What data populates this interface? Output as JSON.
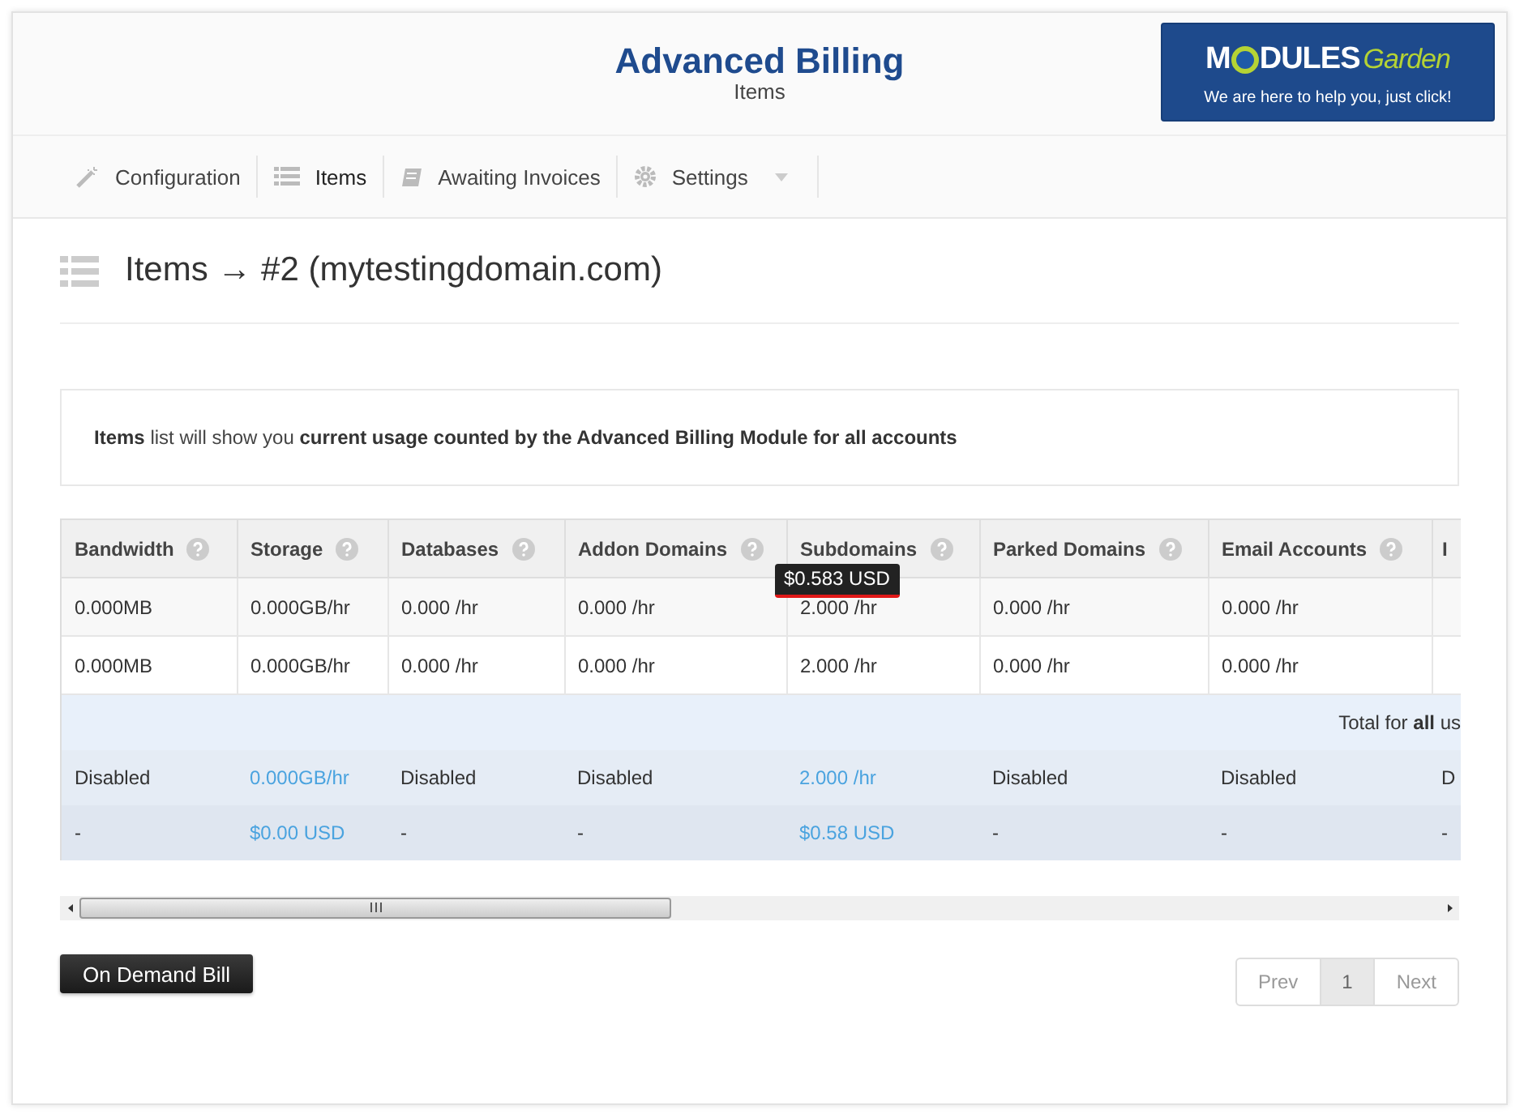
{
  "header": {
    "title": "Advanced Billing",
    "subtitle": "Items",
    "logo": {
      "brand_left": "M",
      "brand_mid": "DULES",
      "brand_right": "Garden",
      "tagline": "We are here to help you, just click!"
    }
  },
  "nav": [
    {
      "label": "Configuration",
      "selected": false,
      "dropdown": false
    },
    {
      "label": "Items",
      "selected": true,
      "dropdown": false
    },
    {
      "label": "Awaiting Invoices",
      "selected": false,
      "dropdown": false
    },
    {
      "label": "Settings",
      "selected": false,
      "dropdown": true
    }
  ],
  "page_title": "Items → #2 (mytestingdomain.com)",
  "info": "**Items** list will show you **current usage counted by the Advanced Billing Module for all accounts**",
  "table": {
    "columns": [
      {
        "label": "Bandwidth"
      },
      {
        "label": "Storage"
      },
      {
        "label": "Databases"
      },
      {
        "label": "Addon Domains"
      },
      {
        "label": "Subdomains",
        "tooltip": "$0.583 USD"
      },
      {
        "label": "Parked Domains"
      },
      {
        "label": "Email Accounts"
      },
      {
        "label": "I"
      }
    ],
    "rows": [
      [
        "0.000MB",
        "0.000GB/hr",
        "0.000 /hr",
        "0.000 /hr",
        "2.000 /hr",
        "0.000 /hr",
        "0.000 /hr"
      ],
      [
        "0.000MB",
        "0.000GB/hr",
        "0.000 /hr",
        "0.000 /hr",
        "2.000 /hr",
        "0.000 /hr",
        "0.000 /hr"
      ]
    ],
    "total_label": "Total for **all** us",
    "summary_rows": [
      [
        {
          "text": "Disabled",
          "link": false
        },
        {
          "text": "0.000GB/hr",
          "link": true
        },
        {
          "text": "Disabled",
          "link": false
        },
        {
          "text": "Disabled",
          "link": false
        },
        {
          "text": "2.000 /hr",
          "link": true
        },
        {
          "text": "Disabled",
          "link": false
        },
        {
          "text": "Disabled",
          "link": false
        },
        {
          "text": "D",
          "link": false
        }
      ],
      [
        {
          "text": "-",
          "link": false
        },
        {
          "text": "$0.00 USD",
          "link": true
        },
        {
          "text": "-",
          "link": false
        },
        {
          "text": "-",
          "link": false
        },
        {
          "text": "$0.58 USD",
          "link": true
        },
        {
          "text": "-",
          "link": false
        },
        {
          "text": "-",
          "link": false
        },
        {
          "text": "-",
          "link": false
        }
      ]
    ]
  },
  "actions": {
    "button": "On Demand Bill"
  },
  "pagination": [
    {
      "label": "Prev",
      "selected": false
    },
    {
      "label": "1",
      "selected": true
    },
    {
      "label": "Next",
      "selected": false
    }
  ]
}
